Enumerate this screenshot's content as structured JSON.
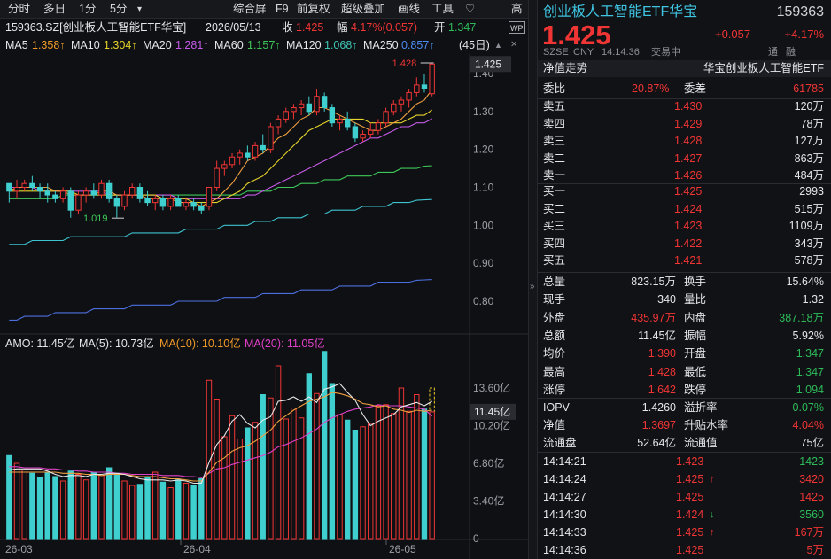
{
  "toolbar": {
    "items": [
      "分时",
      "多日",
      "1分",
      "5分",
      "▾",
      "综合屏",
      "F9",
      "前复权",
      "超级叠加",
      "画线",
      "工具",
      "♡",
      "高"
    ]
  },
  "info": {
    "code": "159363.SZ[创业板人工智能ETF华宝]",
    "date": "2026/05/13",
    "close_label": "收",
    "close": "1.425",
    "change_label": "幅",
    "change": "4.17%(0.057)",
    "open_label": "开",
    "open": "1.347",
    "wp_icon": "WP"
  },
  "ma": {
    "ma5": "MA5",
    "ma5v": "1.358↑",
    "ma10": "MA10",
    "ma10v": "1.304↑",
    "ma20": "MA20",
    "ma20v": "1.281↑",
    "ma60": "MA60",
    "ma60v": "1.157↑",
    "ma120": "MA120",
    "ma120v": "1.068↑",
    "ma250": "MA250",
    "ma250v": "0.857↑",
    "days": "(45日)"
  },
  "price_axis": [
    "1.40",
    "1.30",
    "1.20",
    "1.10",
    "1.00",
    "0.90",
    "0.80"
  ],
  "price_tag": "1.425",
  "annot_high": "1.428",
  "annot_low": "1.019",
  "amo": {
    "amo": "AMO: 11.45亿",
    "ma5": "MA(5): 10.73亿",
    "ma10": "MA(10): 10.10亿",
    "ma20": "MA(20): 11.05亿"
  },
  "vol_axis": [
    "13.60亿",
    "10.20亿",
    "6.80亿",
    "3.40亿",
    "0"
  ],
  "vol_tag": "11.45亿",
  "dates": [
    "26-03",
    "26-04",
    "26-05"
  ],
  "chart_data": {
    "type": "candlestick",
    "ylim": [
      0.75,
      1.45
    ],
    "candles": [
      [
        1.11,
        1.11,
        1.06,
        1.09
      ],
      [
        1.09,
        1.12,
        1.07,
        1.1
      ],
      [
        1.1,
        1.12,
        1.09,
        1.11
      ],
      [
        1.11,
        1.13,
        1.09,
        1.1
      ],
      [
        1.1,
        1.11,
        1.07,
        1.09
      ],
      [
        1.09,
        1.11,
        1.06,
        1.08
      ],
      [
        1.08,
        1.09,
        1.06,
        1.07
      ],
      [
        1.07,
        1.1,
        1.06,
        1.09
      ],
      [
        1.09,
        1.1,
        1.02,
        1.04
      ],
      [
        1.04,
        1.09,
        1.03,
        1.08
      ],
      [
        1.08,
        1.1,
        1.06,
        1.09
      ],
      [
        1.09,
        1.11,
        1.07,
        1.08
      ],
      [
        1.08,
        1.12,
        1.07,
        1.11
      ],
      [
        1.11,
        1.12,
        1.06,
        1.07
      ],
      [
        1.07,
        1.08,
        1.02,
        1.05
      ],
      [
        1.05,
        1.09,
        1.04,
        1.08
      ],
      [
        1.08,
        1.11,
        1.07,
        1.1
      ],
      [
        1.1,
        1.11,
        1.06,
        1.07
      ],
      [
        1.07,
        1.09,
        1.05,
        1.06
      ],
      [
        1.06,
        1.08,
        1.04,
        1.07
      ],
      [
        1.07,
        1.08,
        1.04,
        1.05
      ],
      [
        1.05,
        1.08,
        1.04,
        1.07
      ],
      [
        1.07,
        1.08,
        1.05,
        1.05
      ],
      [
        1.05,
        1.07,
        1.04,
        1.06
      ],
      [
        1.06,
        1.07,
        1.04,
        1.05
      ],
      [
        1.05,
        1.06,
        1.03,
        1.04
      ],
      [
        1.05,
        1.1,
        1.04,
        1.1
      ],
      [
        1.1,
        1.17,
        1.09,
        1.15
      ],
      [
        1.15,
        1.17,
        1.13,
        1.16
      ],
      [
        1.16,
        1.19,
        1.15,
        1.18
      ],
      [
        1.18,
        1.2,
        1.16,
        1.19
      ],
      [
        1.19,
        1.21,
        1.17,
        1.18
      ],
      [
        1.18,
        1.22,
        1.17,
        1.21
      ],
      [
        1.21,
        1.24,
        1.19,
        1.2
      ],
      [
        1.2,
        1.27,
        1.19,
        1.26
      ],
      [
        1.26,
        1.29,
        1.24,
        1.28
      ],
      [
        1.28,
        1.31,
        1.27,
        1.3
      ],
      [
        1.3,
        1.32,
        1.28,
        1.31
      ],
      [
        1.31,
        1.33,
        1.29,
        1.32
      ],
      [
        1.32,
        1.34,
        1.29,
        1.3
      ],
      [
        1.3,
        1.36,
        1.29,
        1.34
      ],
      [
        1.34,
        1.35,
        1.3,
        1.31
      ],
      [
        1.31,
        1.32,
        1.26,
        1.27
      ],
      [
        1.27,
        1.29,
        1.25,
        1.28
      ],
      [
        1.28,
        1.3,
        1.25,
        1.26
      ],
      [
        1.26,
        1.27,
        1.22,
        1.23
      ],
      [
        1.23,
        1.25,
        1.22,
        1.24
      ],
      [
        1.24,
        1.27,
        1.23,
        1.25
      ],
      [
        1.25,
        1.28,
        1.24,
        1.27
      ],
      [
        1.27,
        1.31,
        1.26,
        1.3
      ],
      [
        1.3,
        1.33,
        1.29,
        1.32
      ],
      [
        1.32,
        1.34,
        1.3,
        1.33
      ],
      [
        1.33,
        1.36,
        1.31,
        1.35
      ],
      [
        1.35,
        1.39,
        1.34,
        1.37
      ],
      [
        1.37,
        1.4,
        1.35,
        1.36
      ],
      [
        1.347,
        1.428,
        1.34,
        1.425
      ]
    ],
    "ma5": [
      1.09,
      1.1,
      1.1,
      1.1,
      1.1,
      1.1,
      1.09,
      1.09,
      1.08,
      1.08,
      1.08,
      1.08,
      1.09,
      1.09,
      1.08,
      1.08,
      1.08,
      1.08,
      1.07,
      1.07,
      1.07,
      1.07,
      1.06,
      1.06,
      1.06,
      1.05,
      1.06,
      1.07,
      1.09,
      1.11,
      1.14,
      1.17,
      1.18,
      1.19,
      1.21,
      1.23,
      1.24,
      1.26,
      1.28,
      1.29,
      1.31,
      1.31,
      1.3,
      1.29,
      1.28,
      1.27,
      1.26,
      1.25,
      1.25,
      1.26,
      1.27,
      1.28,
      1.3,
      1.32,
      1.33,
      1.358
    ],
    "ma10": [
      1.09,
      1.09,
      1.09,
      1.09,
      1.09,
      1.09,
      1.09,
      1.09,
      1.09,
      1.08,
      1.08,
      1.08,
      1.08,
      1.08,
      1.08,
      1.08,
      1.08,
      1.08,
      1.08,
      1.08,
      1.07,
      1.07,
      1.07,
      1.07,
      1.06,
      1.06,
      1.06,
      1.06,
      1.07,
      1.08,
      1.09,
      1.11,
      1.12,
      1.13,
      1.15,
      1.17,
      1.19,
      1.21,
      1.23,
      1.25,
      1.26,
      1.27,
      1.28,
      1.28,
      1.28,
      1.28,
      1.28,
      1.27,
      1.27,
      1.27,
      1.27,
      1.27,
      1.28,
      1.29,
      1.29,
      1.304
    ],
    "ma20": [
      1.1,
      1.1,
      1.1,
      1.1,
      1.09,
      1.09,
      1.09,
      1.09,
      1.09,
      1.09,
      1.09,
      1.09,
      1.09,
      1.08,
      1.08,
      1.08,
      1.08,
      1.08,
      1.08,
      1.08,
      1.08,
      1.08,
      1.07,
      1.07,
      1.07,
      1.07,
      1.07,
      1.07,
      1.07,
      1.07,
      1.07,
      1.08,
      1.08,
      1.09,
      1.1,
      1.11,
      1.12,
      1.13,
      1.14,
      1.15,
      1.16,
      1.17,
      1.18,
      1.19,
      1.2,
      1.21,
      1.22,
      1.23,
      1.23,
      1.24,
      1.25,
      1.26,
      1.26,
      1.27,
      1.27,
      1.281
    ],
    "ma60": [
      1.07,
      1.07,
      1.07,
      1.07,
      1.07,
      1.07,
      1.07,
      1.08,
      1.08,
      1.08,
      1.08,
      1.08,
      1.08,
      1.08,
      1.08,
      1.08,
      1.08,
      1.08,
      1.08,
      1.08,
      1.08,
      1.08,
      1.08,
      1.08,
      1.08,
      1.08,
      1.08,
      1.08,
      1.08,
      1.08,
      1.08,
      1.09,
      1.09,
      1.09,
      1.09,
      1.1,
      1.1,
      1.1,
      1.11,
      1.11,
      1.11,
      1.12,
      1.12,
      1.12,
      1.13,
      1.13,
      1.13,
      1.13,
      1.14,
      1.14,
      1.14,
      1.15,
      1.15,
      1.15,
      1.156,
      1.157
    ],
    "ma120": [
      0.95,
      0.95,
      0.95,
      0.96,
      0.96,
      0.96,
      0.96,
      0.96,
      0.97,
      0.97,
      0.97,
      0.97,
      0.97,
      0.97,
      0.97,
      0.97,
      0.98,
      0.98,
      0.98,
      0.98,
      0.98,
      0.98,
      0.98,
      0.99,
      0.99,
      0.99,
      0.99,
      0.99,
      1.0,
      1.0,
      1.0,
      1.0,
      1.01,
      1.01,
      1.01,
      1.02,
      1.02,
      1.02,
      1.02,
      1.03,
      1.03,
      1.03,
      1.04,
      1.04,
      1.04,
      1.04,
      1.05,
      1.05,
      1.05,
      1.05,
      1.06,
      1.06,
      1.06,
      1.066,
      1.067,
      1.068
    ],
    "ma250": [
      0.75,
      0.75,
      0.76,
      0.76,
      0.76,
      0.76,
      0.77,
      0.77,
      0.77,
      0.77,
      0.77,
      0.78,
      0.78,
      0.78,
      0.78,
      0.78,
      0.79,
      0.79,
      0.79,
      0.79,
      0.79,
      0.79,
      0.8,
      0.8,
      0.8,
      0.8,
      0.8,
      0.8,
      0.81,
      0.81,
      0.81,
      0.81,
      0.81,
      0.82,
      0.82,
      0.82,
      0.82,
      0.82,
      0.83,
      0.83,
      0.83,
      0.83,
      0.83,
      0.84,
      0.84,
      0.84,
      0.84,
      0.84,
      0.85,
      0.85,
      0.85,
      0.85,
      0.85,
      0.855,
      0.856,
      0.857
    ],
    "volume": [
      7.5,
      6.8,
      6.2,
      5.9,
      5.5,
      6.0,
      5.6,
      5.2,
      6.1,
      5.8,
      5.3,
      6.0,
      5.7,
      6.4,
      5.9,
      5.2,
      4.8,
      4.9,
      5.5,
      6.0,
      5.1,
      4.6,
      5.3,
      5.0,
      4.8,
      5.4,
      14.3,
      12.6,
      9.2,
      11.1,
      9.0,
      10.0,
      10.5,
      13.0,
      12.7,
      15.6,
      10.8,
      11.8,
      10.9,
      14.9,
      13.1,
      16.9,
      14.0,
      11.2,
      10.7,
      9.8,
      10.1,
      10.4,
      12.0,
      12.1,
      11.3,
      13.6,
      11.5,
      13.0,
      11.7,
      11.45
    ],
    "vol_up": [
      false,
      true,
      true,
      false,
      false,
      false,
      false,
      true,
      false,
      true,
      true,
      false,
      true,
      false,
      false,
      true,
      true,
      false,
      false,
      true,
      false,
      true,
      false,
      true,
      false,
      false,
      true,
      true,
      true,
      true,
      true,
      false,
      true,
      false,
      true,
      true,
      true,
      true,
      true,
      false,
      true,
      false,
      false,
      true,
      false,
      false,
      true,
      true,
      true,
      true,
      true,
      true,
      true,
      true,
      false,
      true
    ],
    "vol_ma5": [
      6.2,
      6.3,
      6.3,
      6.3,
      6.3,
      6.1,
      5.8,
      5.6,
      5.7,
      5.7,
      5.6,
      5.8,
      5.8,
      5.9,
      5.9,
      5.8,
      5.6,
      5.4,
      5.3,
      5.3,
      5.3,
      5.2,
      5.3,
      5.2,
      5.0,
      5.0,
      6.9,
      8.5,
      9.3,
      10.6,
      11.2,
      10.4,
      10.0,
      10.7,
      11.0,
      12.4,
      12.5,
      12.8,
      12.4,
      12.8,
      12.3,
      13.5,
      13.7,
      14.0,
      13.2,
      12.5,
      11.2,
      10.2,
      10.6,
      10.9,
      11.2,
      11.9,
      12.1,
      12.3,
      12.0,
      12.4
    ],
    "vol_ma10": [
      6.0,
      6.0,
      6.0,
      6.0,
      6.0,
      6.0,
      6.0,
      5.9,
      5.9,
      5.9,
      5.8,
      5.8,
      5.7,
      5.8,
      5.8,
      5.8,
      5.7,
      5.6,
      5.6,
      5.6,
      5.5,
      5.4,
      5.4,
      5.3,
      5.2,
      5.2,
      6.0,
      6.9,
      7.3,
      7.9,
      8.2,
      8.4,
      8.8,
      9.3,
      9.8,
      10.6,
      11.1,
      11.6,
      12.0,
      12.4,
      12.6,
      12.8,
      13.2,
      13.1,
      12.9,
      12.6,
      12.2,
      12.1,
      11.9,
      12.0,
      11.7,
      11.6,
      11.4,
      11.6,
      11.5,
      11.6
    ],
    "vol_ma20": [
      6.5,
      6.5,
      6.4,
      6.4,
      6.4,
      6.3,
      6.3,
      6.2,
      6.2,
      6.1,
      6.1,
      6.0,
      6.0,
      6.0,
      5.9,
      5.9,
      5.8,
      5.8,
      5.8,
      5.8,
      5.7,
      5.7,
      5.7,
      5.6,
      5.6,
      5.5,
      5.9,
      6.3,
      6.4,
      6.7,
      6.9,
      7.1,
      7.3,
      7.5,
      7.8,
      8.3,
      8.5,
      8.8,
      9.1,
      9.5,
      9.9,
      10.5,
      10.9,
      11.2,
      11.5,
      11.7,
      11.8,
      11.9,
      12.1,
      12.0,
      12.0,
      12.0,
      11.9,
      11.8,
      11.7,
      11.05
    ]
  },
  "right": {
    "title": "创业板人工智能ETF华宝",
    "code": "159363",
    "price": "1.425",
    "change": "+0.057",
    "pct": "+4.17%",
    "sub": [
      "SZSE",
      "CNY",
      "14:14:36",
      "交易中"
    ],
    "nav_label": "净值走势",
    "nav_name": "华宝创业板人工智能ETF",
    "tong": "通",
    "rong": "融",
    "webi_label": "委比",
    "webi": "20.87%",
    "weicha_label": "委差",
    "weicha": "61785",
    "asks": [
      {
        "label": "卖五",
        "price": "1.430",
        "vol": "120万"
      },
      {
        "label": "卖四",
        "price": "1.429",
        "vol": "78万"
      },
      {
        "label": "卖三",
        "price": "1.428",
        "vol": "127万"
      },
      {
        "label": "卖二",
        "price": "1.427",
        "vol": "863万"
      },
      {
        "label": "卖一",
        "price": "1.426",
        "vol": "484万"
      }
    ],
    "bids": [
      {
        "label": "买一",
        "price": "1.425",
        "vol": "2993"
      },
      {
        "label": "买二",
        "price": "1.424",
        "vol": "515万"
      },
      {
        "label": "买三",
        "price": "1.423",
        "vol": "1109万"
      },
      {
        "label": "买四",
        "price": "1.422",
        "vol": "343万"
      },
      {
        "label": "买五",
        "price": "1.421",
        "vol": "578万"
      }
    ],
    "stats": [
      {
        "l1": "总量",
        "v1": "823.15万",
        "l2": "换手",
        "v2": "15.64%",
        "c1": "white",
        "c2": "white"
      },
      {
        "l1": "现手",
        "v1": "340",
        "l2": "量比",
        "v2": "1.32",
        "c1": "white",
        "c2": "white"
      },
      {
        "l1": "外盘",
        "v1": "435.97万",
        "l2": "内盘",
        "v2": "387.18万",
        "c1": "red",
        "c2": "green"
      },
      {
        "l1": "总额",
        "v1": "11.45亿",
        "l2": "振幅",
        "v2": "5.92%",
        "c1": "white",
        "c2": "white"
      },
      {
        "l1": "均价",
        "v1": "1.390",
        "l2": "开盘",
        "v2": "1.347",
        "c1": "red",
        "c2": "green"
      },
      {
        "l1": "最高",
        "v1": "1.428",
        "l2": "最低",
        "v2": "1.347",
        "c1": "red",
        "c2": "green"
      },
      {
        "l1": "涨停",
        "v1": "1.642",
        "l2": "跌停",
        "v2": "1.094",
        "c1": "red",
        "c2": "green"
      }
    ],
    "iopv": [
      {
        "l1": "IOPV",
        "v1": "1.4260",
        "l2": "溢折率",
        "v2": "-0.07%",
        "c1": "white",
        "c2": "green"
      },
      {
        "l1": "净值",
        "v1": "1.3697",
        "l2": "升贴水率",
        "v2": "4.04%",
        "c1": "red",
        "c2": "red"
      },
      {
        "l1": "流通盘",
        "v1": "52.64亿",
        "l2": "流通值",
        "v2": "75亿",
        "c1": "white",
        "c2": "white"
      }
    ],
    "ticks": [
      {
        "time": "14:14:21",
        "price": "1.423",
        "arrow": "",
        "vol": "1423",
        "vc": "green"
      },
      {
        "time": "14:14:24",
        "price": "1.425",
        "arrow": "up",
        "vol": "3420",
        "vc": "red"
      },
      {
        "time": "14:14:27",
        "price": "1.425",
        "arrow": "",
        "vol": "1425",
        "vc": "red"
      },
      {
        "time": "14:14:30",
        "price": "1.424",
        "arrow": "down",
        "vol": "3560",
        "vc": "green"
      },
      {
        "time": "14:14:33",
        "price": "1.425",
        "arrow": "up",
        "vol": "167万",
        "vc": "red"
      },
      {
        "time": "14:14:36",
        "price": "1.425",
        "arrow": "",
        "vol": "5万",
        "vc": "red"
      }
    ]
  },
  "colors": {
    "up": "#f13535",
    "down": "#3fcfcf",
    "bg": "#0f1013"
  }
}
